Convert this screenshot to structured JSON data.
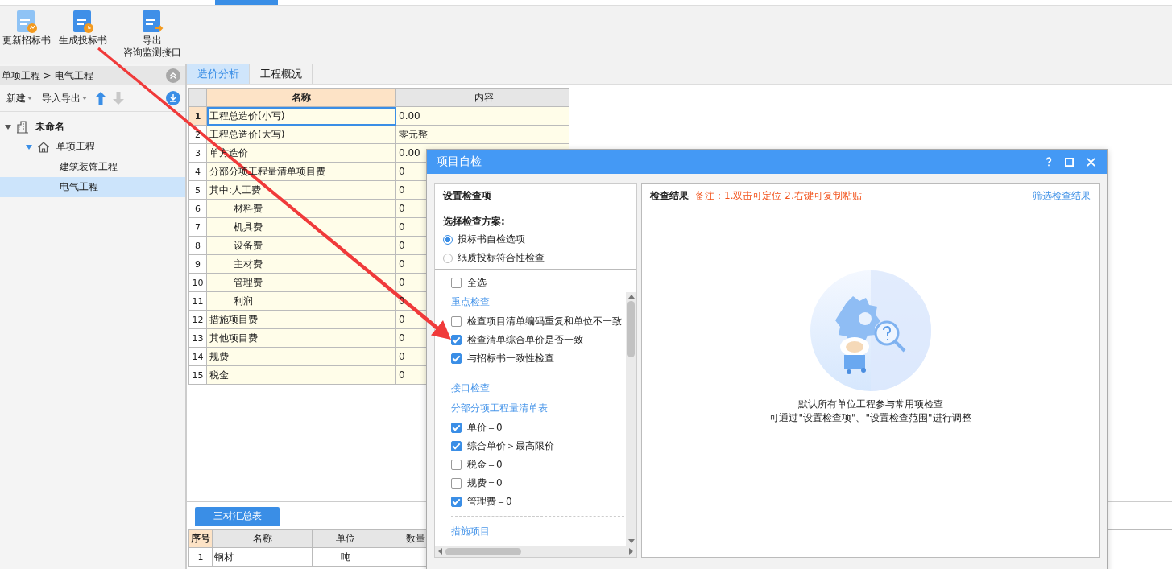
{
  "ribbon": {
    "buttons": [
      {
        "kind": "update",
        "lines": [
          "更新招标书"
        ]
      },
      {
        "kind": "generate",
        "lines": [
          "生成投标书"
        ]
      },
      {
        "kind": "export",
        "lines": [
          "导出",
          "咨询监测接口"
        ]
      }
    ]
  },
  "sidebar": {
    "breadcrumb": "单项工程 > 电气工程",
    "toolbar": [
      {
        "label": "新建"
      },
      {
        "label": "导入导出"
      }
    ],
    "tree": [
      {
        "label": "未命名",
        "kind": "project",
        "expanded": true,
        "selected": false,
        "children": [
          {
            "label": "单项工程",
            "kind": "single",
            "expanded": true,
            "selected": false,
            "children": [
              {
                "label": "建筑装饰工程",
                "selected": false
              },
              {
                "label": "电气工程",
                "selected": true
              }
            ]
          }
        ]
      }
    ]
  },
  "tabs": [
    {
      "label": "造价分析",
      "selected": true
    },
    {
      "label": "工程概况",
      "selected": false
    }
  ],
  "table": {
    "columns": [
      "名称",
      "内容"
    ],
    "rows": [
      {
        "no": "1",
        "name": "工程总造价(小写)",
        "content": "0.00",
        "selected": true
      },
      {
        "no": "2",
        "name": "工程总造价(大写)",
        "content": "零元整",
        "selected": false
      },
      {
        "no": "3",
        "name": "单方造价",
        "content": "0.00",
        "selected": false
      },
      {
        "no": "4",
        "name": "分部分项工程量清单项目费",
        "content": "0",
        "selected": false
      },
      {
        "no": "5",
        "name": "其中:人工费",
        "content": "0",
        "selected": false,
        "children": [
          {
            "no": "6",
            "name": "材料费",
            "content": "0",
            "selected": false
          },
          {
            "no": "7",
            "name": "机具费",
            "content": "0",
            "selected": false
          },
          {
            "no": "8",
            "name": "设备费",
            "content": "0",
            "selected": false
          },
          {
            "no": "9",
            "name": "主材费",
            "content": "0",
            "selected": false
          },
          {
            "no": "10",
            "name": "管理费",
            "content": "0",
            "selected": false
          },
          {
            "no": "11",
            "name": "利润",
            "content": "0",
            "selected": false
          }
        ]
      },
      {
        "no": "12",
        "name": "措施项目费",
        "content": "0",
        "selected": false
      },
      {
        "no": "13",
        "name": "其他项目费",
        "content": "0",
        "selected": false
      },
      {
        "no": "14",
        "name": "规费",
        "content": "0",
        "selected": false
      },
      {
        "no": "15",
        "name": "税金",
        "content": "0",
        "selected": false
      }
    ]
  },
  "bottom": {
    "tabs": [
      {
        "label": "三材汇总表",
        "selected": true
      }
    ],
    "columns": [
      "序号",
      "名称",
      "单位",
      "数量"
    ],
    "rows": [
      {
        "no": "1",
        "name": "钢材",
        "unit": "吨"
      }
    ]
  },
  "dialog": {
    "title": "项目自检",
    "left": {
      "header": "设置检查项",
      "scheme_label": "选择检查方案:",
      "schemes": [
        {
          "label": "投标书自检选项",
          "selected": true
        },
        {
          "label": "纸质投标符合性检查",
          "selected": false
        }
      ],
      "items": [
        {
          "kind": "checkbox",
          "label": "全选",
          "checked": false
        },
        {
          "kind": "heading",
          "label": "重点检查"
        },
        {
          "kind": "checkbox",
          "label": "检查项目清单编码重复和单位不一致",
          "checked": false
        },
        {
          "kind": "checkbox",
          "label": "检查清单综合单价是否一致",
          "checked": true
        },
        {
          "kind": "checkbox",
          "label": "与招标书一致性检查",
          "checked": true
        },
        {
          "kind": "divider"
        },
        {
          "kind": "heading",
          "label": "接口检查"
        },
        {
          "kind": "heading",
          "label": "分部分项工程量清单表"
        },
        {
          "kind": "checkbox",
          "label": "单价＝0",
          "checked": true
        },
        {
          "kind": "checkbox",
          "label": "综合单价＞最高限价",
          "checked": true
        },
        {
          "kind": "checkbox",
          "label": "税金＝0",
          "checked": false
        },
        {
          "kind": "checkbox",
          "label": "规费＝0",
          "checked": false
        },
        {
          "kind": "checkbox",
          "label": "管理费＝0",
          "checked": true
        },
        {
          "kind": "divider"
        },
        {
          "kind": "heading",
          "label": "措施项目"
        }
      ]
    },
    "right": {
      "header": "检查结果",
      "note": "备注：1.双击可定位 2.右键可复制粘贴",
      "filter_link": "筛选检查结果",
      "empty_lines": [
        "默认所有单位工程参与常用项检查",
        "可通过\"设置检查项\"、\"设置检查范围\"进行调整"
      ]
    }
  }
}
